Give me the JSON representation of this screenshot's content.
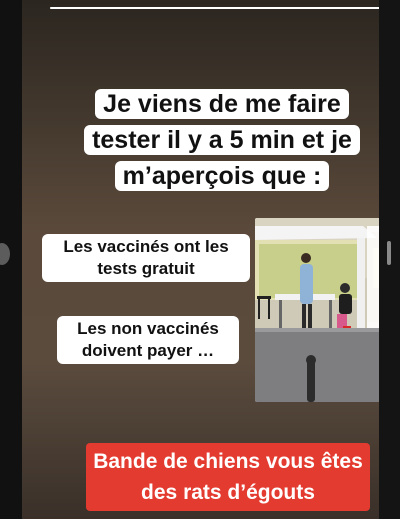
{
  "story": {
    "progress": 1.0,
    "headline": "Je viens de me faire tester il y a 5 min et je m’aperçois que :",
    "bubble_1": "Les vaccinés ont les tests gratuit",
    "bubble_2": "Les non vaccinés doivent payer …",
    "cta": "Bande de chiens vous êtes des rats d’égouts",
    "photo_icon": "test-tent-photo"
  },
  "colors": {
    "background": "#5b4a3b",
    "cta": "#e43b30",
    "text": "#111111"
  }
}
